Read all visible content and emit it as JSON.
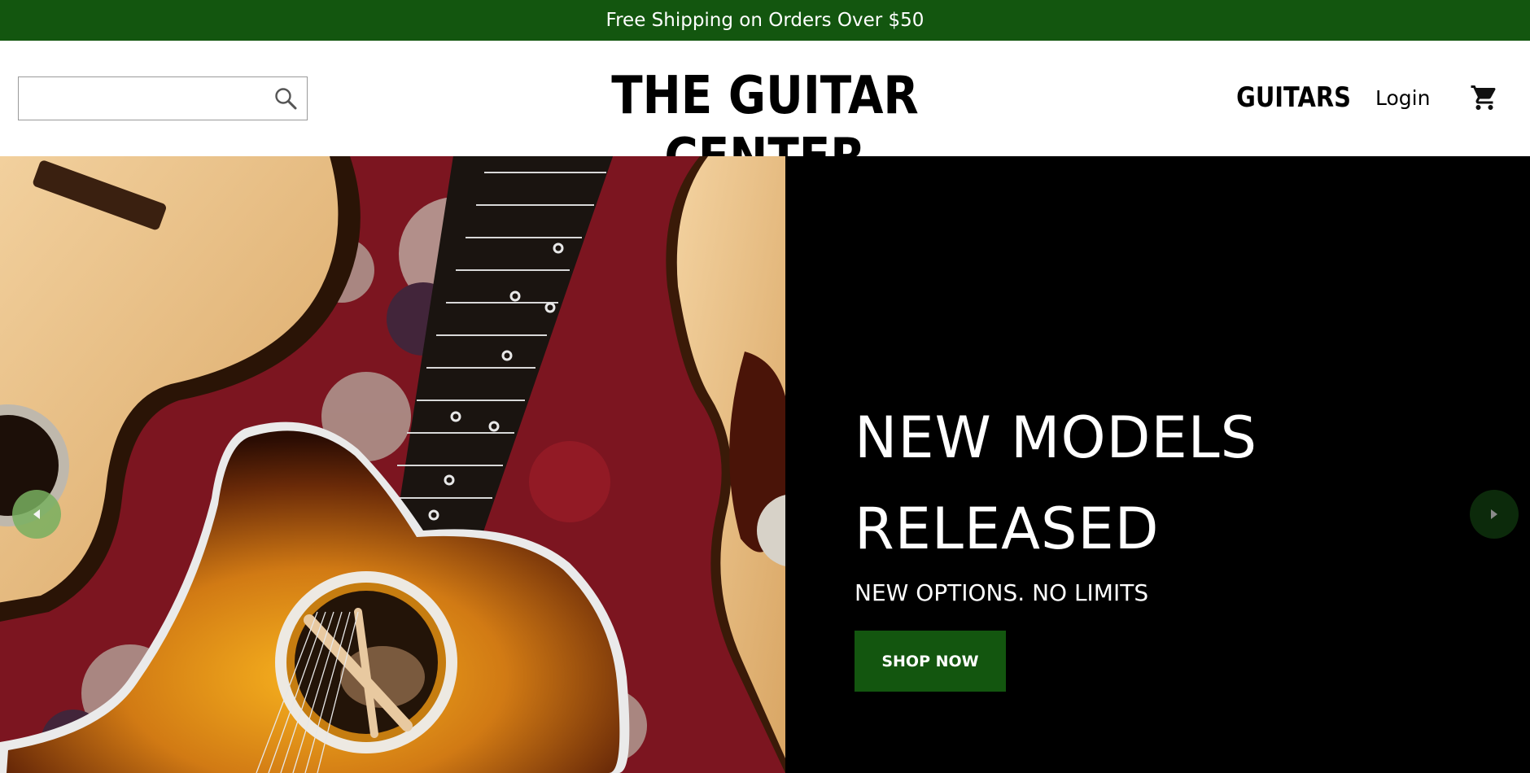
{
  "promo_bar": {
    "text": "Free Shipping on Orders Over $50"
  },
  "header": {
    "search": {
      "value": "",
      "placeholder": ""
    },
    "logo": "THE GUITAR CENTER",
    "nav": {
      "guitars": "GUITARS",
      "login": "Login"
    }
  },
  "hero": {
    "heading": "NEW MODELS RELEASED",
    "subheading": "NEW OPTIONS. NO LIMITS",
    "cta": "SHOP NOW"
  },
  "icons": {
    "search": "search-icon",
    "cart": "cart-icon",
    "prev": "chevron-left-icon",
    "next": "chevron-right-icon"
  },
  "colors": {
    "brand_green": "#13560f",
    "hero_background": "#000000",
    "prev_arrow": "#78af5f",
    "next_arrow": "#0c2a0b"
  }
}
